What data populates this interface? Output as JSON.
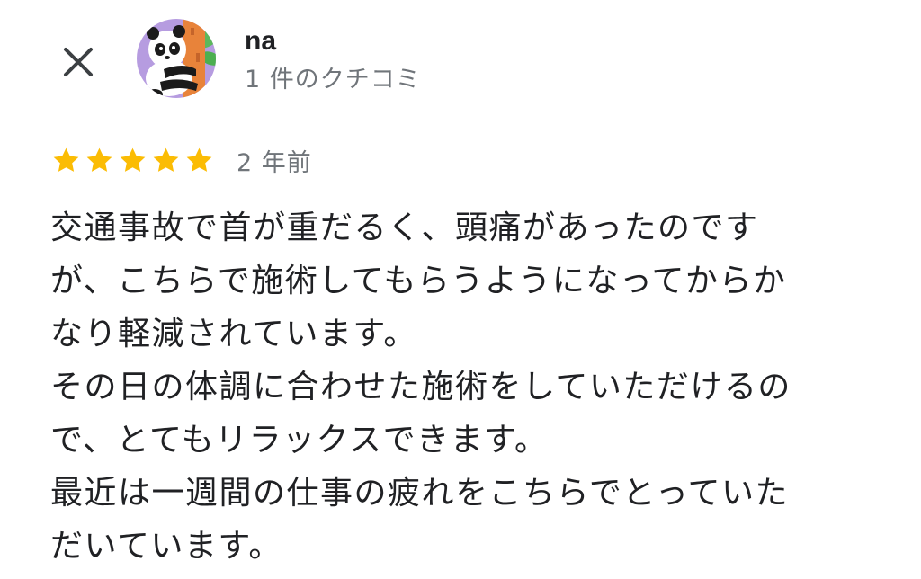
{
  "reviewer": {
    "name": "na",
    "review_count": "1 件のクチコミ"
  },
  "review": {
    "rating": 5,
    "max_rating": 5,
    "star_color": "#fbbc04",
    "time_ago": "2 年前",
    "lines": [
      "交通事故で首が重だるく、頭痛があったのです",
      "が、こちらで施術してもらうようになってからか",
      "なり軽減されています。",
      "その日の体調に合わせた施術をしていただけるの",
      "で、とてもリラックスできます。",
      "最近は一週間の仕事の疲れをこちらでとっていた",
      "だいています。"
    ]
  },
  "icons": {
    "close": "close-icon",
    "avatar": "panda-avatar",
    "star": "star-icon"
  }
}
